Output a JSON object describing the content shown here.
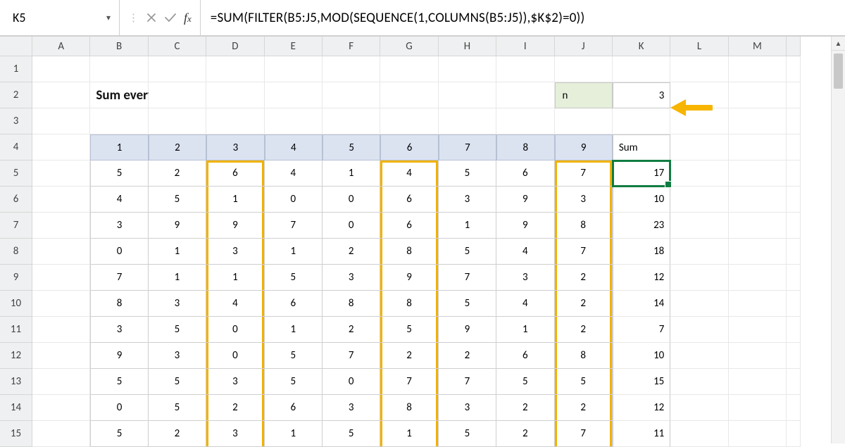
{
  "name_box": "K5",
  "formula": "=SUM(FILTER(B5:J5,MOD(SEQUENCE(1,COLUMNS(B5:J5)),$K$2)=0))",
  "title": "Sum every nth column",
  "n_label": "n",
  "n_value": 3,
  "columns": [
    "A",
    "B",
    "C",
    "D",
    "E",
    "F",
    "G",
    "H",
    "I",
    "J",
    "K",
    "L",
    "M"
  ],
  "row_numbers": [
    1,
    2,
    3,
    4,
    5,
    6,
    7,
    8,
    9,
    10,
    11,
    12,
    13,
    14,
    15
  ],
  "header_row": {
    "nums": [
      1,
      2,
      3,
      4,
      5,
      6,
      7,
      8,
      9
    ],
    "sum_label": "Sum"
  },
  "data": [
    {
      "vals": [
        5,
        2,
        6,
        4,
        1,
        4,
        5,
        6,
        7
      ],
      "sum": 17
    },
    {
      "vals": [
        4,
        5,
        1,
        0,
        0,
        6,
        3,
        9,
        3
      ],
      "sum": 10
    },
    {
      "vals": [
        3,
        9,
        9,
        7,
        0,
        6,
        1,
        9,
        8
      ],
      "sum": 23
    },
    {
      "vals": [
        0,
        1,
        3,
        1,
        2,
        8,
        5,
        4,
        7
      ],
      "sum": 18
    },
    {
      "vals": [
        7,
        1,
        1,
        5,
        3,
        9,
        7,
        3,
        2
      ],
      "sum": 12
    },
    {
      "vals": [
        8,
        3,
        4,
        6,
        8,
        8,
        5,
        4,
        2
      ],
      "sum": 14
    },
    {
      "vals": [
        3,
        5,
        0,
        1,
        2,
        5,
        9,
        1,
        2
      ],
      "sum": 7
    },
    {
      "vals": [
        9,
        3,
        0,
        5,
        7,
        2,
        2,
        6,
        8
      ],
      "sum": 10
    },
    {
      "vals": [
        5,
        5,
        3,
        5,
        0,
        7,
        7,
        5,
        5
      ],
      "sum": 15
    },
    {
      "vals": [
        0,
        5,
        2,
        6,
        3,
        8,
        3,
        2,
        2
      ],
      "sum": 12
    },
    {
      "vals": [
        5,
        2,
        3,
        1,
        5,
        1,
        5,
        2,
        7
      ],
      "sum": 11
    }
  ],
  "highlight_cols": [
    3,
    6,
    9
  ],
  "active_cell": {
    "row": 5,
    "col": "K"
  },
  "chart_data": {
    "type": "table",
    "title": "Sum every nth column",
    "n": 3,
    "columns": [
      "1",
      "2",
      "3",
      "4",
      "5",
      "6",
      "7",
      "8",
      "9",
      "Sum"
    ],
    "rows": [
      [
        5,
        2,
        6,
        4,
        1,
        4,
        5,
        6,
        7,
        17
      ],
      [
        4,
        5,
        1,
        0,
        0,
        6,
        3,
        9,
        3,
        10
      ],
      [
        3,
        9,
        9,
        7,
        0,
        6,
        1,
        9,
        8,
        23
      ],
      [
        0,
        1,
        3,
        1,
        2,
        8,
        5,
        4,
        7,
        18
      ],
      [
        7,
        1,
        1,
        5,
        3,
        9,
        7,
        3,
        2,
        12
      ],
      [
        8,
        3,
        4,
        6,
        8,
        8,
        5,
        4,
        2,
        14
      ],
      [
        3,
        5,
        0,
        1,
        2,
        5,
        9,
        1,
        2,
        7
      ],
      [
        9,
        3,
        0,
        5,
        7,
        2,
        2,
        6,
        8,
        10
      ],
      [
        5,
        5,
        3,
        5,
        0,
        7,
        7,
        5,
        5,
        15
      ],
      [
        0,
        5,
        2,
        6,
        3,
        8,
        3,
        2,
        2,
        12
      ],
      [
        5,
        2,
        3,
        1,
        5,
        1,
        5,
        2,
        7,
        11
      ]
    ],
    "highlighted_columns": [
      3,
      6,
      9
    ]
  }
}
